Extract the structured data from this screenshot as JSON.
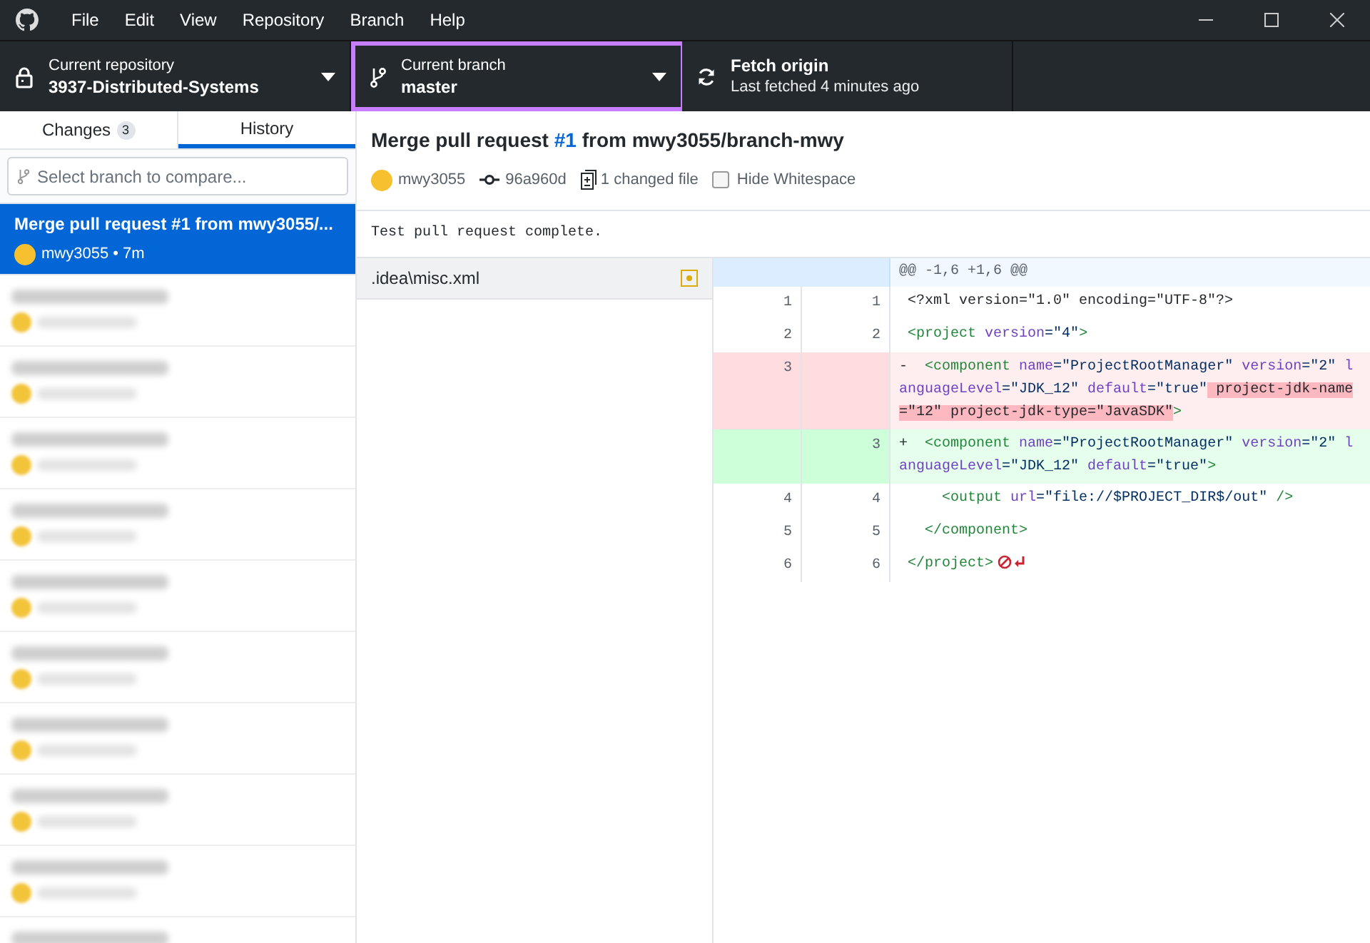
{
  "menu": [
    "File",
    "Edit",
    "View",
    "Repository",
    "Branch",
    "Help"
  ],
  "toolbar": [
    {
      "kind": "repository",
      "label": "Current repository",
      "value": "3937-Distributed-Systems",
      "selected": false
    },
    {
      "kind": "branch",
      "label": "Current branch",
      "value": "master",
      "selected": true
    },
    {
      "kind": "fetch",
      "label": "Fetch origin",
      "value": "Last fetched 4 minutes ago",
      "selected": false
    }
  ],
  "tabs": [
    {
      "label": "Changes",
      "count": "3",
      "selected": false
    },
    {
      "label": "History",
      "selected": true
    }
  ],
  "branch_compare": {
    "placeholder": "Select branch to compare..."
  },
  "history": [
    {
      "kind": "commit",
      "title": "Merge pull request #1 from mwy3055/...",
      "meta": "mwy3055 • 7m",
      "selected": true
    },
    {
      "kind": "blurred"
    },
    {
      "kind": "blurred"
    },
    {
      "kind": "blurred"
    },
    {
      "kind": "blurred"
    },
    {
      "kind": "blurred"
    },
    {
      "kind": "blurred"
    },
    {
      "kind": "blurred"
    },
    {
      "kind": "blurred"
    },
    {
      "kind": "blurred"
    },
    {
      "kind": "blurred"
    }
  ],
  "commit": {
    "title": "Merge pull request **#1** from mwy3055/branch-mwy",
    "author": "mwy3055",
    "sha": "96a960d",
    "files_changed": "1 changed file",
    "hide_whitespace": {
      "label": "Hide Whitespace",
      "checked": false
    },
    "description": "Test pull request complete."
  },
  "files": [
    {
      "name": ".idea\\misc.xml",
      "kind": "modified",
      "selected": true
    }
  ],
  "diff": {
    "hunk": "@@ -1,6 +1,6 @@",
    "lines": [
      {
        "kind": "context",
        "old": "1",
        "new": "1",
        "tokens": [
          {
            "t": " <?xml version=\"1.0\" encoding=\"UTF-8\"?>",
            "kind": "plain"
          }
        ]
      },
      {
        "kind": "context",
        "old": "2",
        "new": "2",
        "tokens": [
          {
            "t": " <project",
            "kind": "tag"
          },
          {
            "t": " version",
            "kind": "attr"
          },
          {
            "t": "=\"4\"",
            "kind": "str"
          },
          {
            "t": ">",
            "kind": "tag"
          }
        ]
      },
      {
        "kind": "deleted",
        "old": "3",
        "tokens": [
          {
            "t": "-  ",
            "kind": "plain"
          },
          {
            "t": "<component",
            "kind": "tag"
          },
          {
            "t": " name",
            "kind": "attr"
          },
          {
            "t": "=\"ProjectRootManager\"",
            "kind": "str"
          },
          {
            "t": " version",
            "kind": "attr"
          },
          {
            "t": "=\"2\"",
            "kind": "str"
          },
          {
            "t": " languageLevel",
            "kind": "attr"
          },
          {
            "t": "=\"JDK_12\"",
            "kind": "str"
          },
          {
            "t": " default",
            "kind": "attr"
          },
          {
            "t": "=\"true\"",
            "kind": "str"
          },
          {
            "t": " project-jdk-name=\"12\" project-jdk-type=\"JavaSDK\"",
            "kind": "changed"
          },
          {
            "t": ">",
            "kind": "tag"
          }
        ]
      },
      {
        "kind": "added",
        "new": "3",
        "tokens": [
          {
            "t": "+  ",
            "kind": "plain"
          },
          {
            "t": "<component",
            "kind": "tag"
          },
          {
            "t": " name",
            "kind": "attr"
          },
          {
            "t": "=\"ProjectRootManager\"",
            "kind": "str"
          },
          {
            "t": " version",
            "kind": "attr"
          },
          {
            "t": "=\"2\"",
            "kind": "str"
          },
          {
            "t": " languageLevel",
            "kind": "attr"
          },
          {
            "t": "=\"JDK_12\"",
            "kind": "str"
          },
          {
            "t": " default",
            "kind": "attr"
          },
          {
            "t": "=\"true\"",
            "kind": "str"
          },
          {
            "t": ">",
            "kind": "tag"
          }
        ]
      },
      {
        "kind": "context",
        "old": "4",
        "new": "4",
        "tokens": [
          {
            "t": "     <output",
            "kind": "tag"
          },
          {
            "t": " url",
            "kind": "attr"
          },
          {
            "t": "=\"file://$PROJECT_DIR$/out\"",
            "kind": "str"
          },
          {
            "t": " />",
            "kind": "tag"
          }
        ]
      },
      {
        "kind": "context",
        "old": "5",
        "new": "5",
        "tokens": [
          {
            "t": "   </component>",
            "kind": "tag"
          }
        ]
      },
      {
        "kind": "context",
        "old": "6",
        "new": "6",
        "no_newline": true,
        "tokens": [
          {
            "t": " </project>",
            "kind": "tag"
          }
        ]
      }
    ]
  }
}
